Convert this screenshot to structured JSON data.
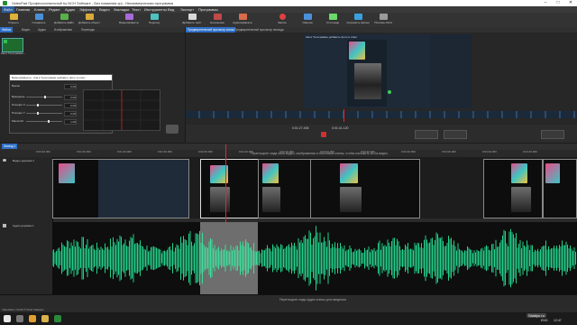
{
  "window": {
    "title": "VideoPad Профессиональный by NCH Software - Без названия.vpj - Некоммерческая программа"
  },
  "menu": [
    "Файл",
    "Главная",
    "Клипы",
    "Редакт",
    "Аудио",
    "Эффекты",
    "Видео",
    "Закладки",
    "Текст",
    "Инструменты",
    "Вид",
    "Экспорт",
    "Программы"
  ],
  "toolbar": {
    "buttons": [
      {
        "label": "Открыть",
        "color": "#e0b23a"
      },
      {
        "label": "Сохранить",
        "color": "#4a90d9"
      },
      {
        "label": "Добавить файл",
        "color": "#59b04b"
      },
      {
        "label": "Добавить объект",
        "color": "#d9a93a"
      },
      {
        "label": "Видеоэффекты",
        "color": "#a86ad9"
      },
      {
        "label": "Переход",
        "color": "#4fc0c0"
      },
      {
        "label": "Добавить текст",
        "color": "#d9d9d9"
      },
      {
        "label": "Наложение",
        "color": "#c04a4a"
      },
      {
        "label": "Аудиоэффекты",
        "color": "#d96a4a"
      },
      {
        "label": "Запись",
        "color": "#e04040"
      },
      {
        "label": "Озвучка",
        "color": "#4a90d9"
      },
      {
        "label": "Стоп-кадр",
        "color": "#6ad96a"
      },
      {
        "label": "Сохранить фильм",
        "color": "#3aa0e0"
      },
      {
        "label": "Плагины NCH",
        "color": "#9a9a9a"
      }
    ]
  },
  "left_tabs": [
    "Файлы",
    "Видео",
    "Аудио",
    "Изображения",
    "Переходы"
  ],
  "media": {
    "thumb_label": "Как в Телеграмме..."
  },
  "fx_window": {
    "title": "Видеоэффекты - Как в Телеграмме добавить фото в ответ",
    "rows": [
      {
        "label": "Время",
        "value": "0.00"
      },
      {
        "label": "Вращение",
        "value": "0.00"
      },
      {
        "label": "Позиция X",
        "value": "0.00"
      },
      {
        "label": "Позиция Y",
        "value": "0.00"
      },
      {
        "label": "Масштаб",
        "value": "1.00"
      }
    ]
  },
  "preview_tabs": [
    "Предварительный просмотр клипа",
    "Предварительный просмотр эпизода"
  ],
  "preview": {
    "post_title": "Как в Телеграмме добавить фото в ответ",
    "time_left": "0:01:27.406",
    "time_right": "0:01:41.120"
  },
  "timeline": {
    "sequence_tab": "Эпизод 1",
    "ruler": [
      "0:00:40.000",
      "0:01:00.000",
      "0:01:20.000",
      "0:01:40.000",
      "0:02:00.000",
      "0:02:20.000",
      "0:02:40.000",
      "0:03:00.000",
      "0:03:20.000",
      "0:03:40.000",
      "0:04:00.000",
      "0:04:20.000",
      "0:04:40.000"
    ],
    "video_track_label": "Видео дорожка 1",
    "audio_track_label": "Аудио дорожка 1",
    "overlay_hint": "Перетащите сюда свои видео, изображения и текстовые клипы, чтобы наложить их на видео",
    "audio_hint": "Перетащите сюда аудио клипы для сведения"
  },
  "status": {
    "text": "VideoPad v 10.05 © NCH Software"
  },
  "taskbar": {
    "clock": "12:47",
    "lang": "ENG"
  },
  "watermark": "Salalyo.ru"
}
